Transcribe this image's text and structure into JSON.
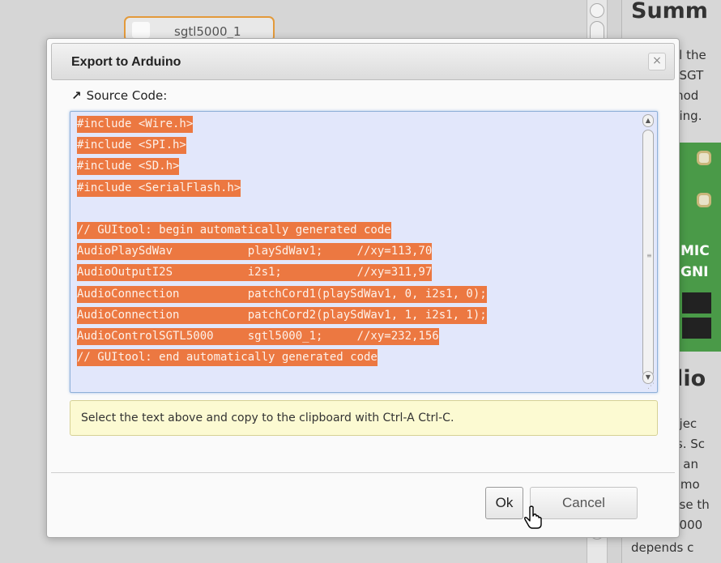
{
  "background": {
    "node_label": "sgtl5000_1",
    "sidebar": {
      "heading_summary": "Summ",
      "summary_lines": [
        "ol the",
        ". SGT",
        "mod",
        "ning."
      ],
      "board_text": [
        "MIC",
        "GNI"
      ],
      "heading_audio": "dio",
      "audio_lines": [
        "bjec",
        "ts. Sc",
        "d an",
        "r mo",
        "use th",
        "5000",
        "depends c"
      ]
    }
  },
  "dialog": {
    "title": "Export to Arduino",
    "close_label": "×",
    "source_label": "Source Code:",
    "source_icon": "↗",
    "code_lines": [
      "#include <Wire.h>",
      "#include <SPI.h>",
      "#include <SD.h>",
      "#include <SerialFlash.h>",
      "",
      "// GUItool: begin automatically generated code",
      "AudioPlaySdWav           playSdWav1;     //xy=113,70",
      "AudioOutputI2S           i2s1;           //xy=311,97",
      "AudioConnection          patchCord1(playSdWav1, 0, i2s1, 0);",
      "AudioConnection          patchCord2(playSdWav1, 1, i2s1, 1);",
      "AudioControlSGTL5000     sgtl5000_1;     //xy=232,156",
      "// GUItool: end automatically generated code"
    ],
    "hint": "Select the text above and copy to the clipboard with Ctrl-A Ctrl-C.",
    "ok_label": "Ok",
    "cancel_label": "Cancel"
  },
  "colors": {
    "selection": "#ec7841",
    "code_bg": "#e2e7fb",
    "hint_bg": "#fcfad2"
  }
}
